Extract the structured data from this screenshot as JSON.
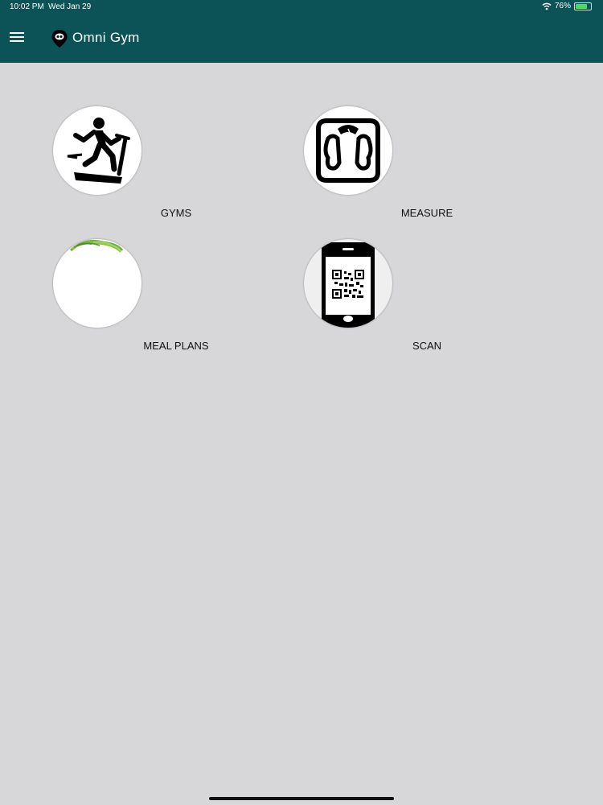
{
  "status_bar": {
    "time": "10:02 PM",
    "date": "Wed Jan 29",
    "battery_percent": "76%",
    "battery_level": 0.76,
    "icons": [
      "wifi-icon",
      "battery-icon"
    ]
  },
  "app_bar": {
    "title": "Omni Gym",
    "menu_icon": "hamburger-menu-icon",
    "logo_icon": "location-pin-logo-icon",
    "background_color": "#0c5357"
  },
  "tiles": [
    {
      "label": "GYMS",
      "icon": "treadmill-runner-icon"
    },
    {
      "label": "MEASURE",
      "icon": "bathroom-scale-icon"
    },
    {
      "label": "MEAL PLANS",
      "icon": "salad-plate-icon"
    },
    {
      "label": "SCAN",
      "icon": "phone-qr-code-icon"
    }
  ],
  "colors": {
    "background": "#d7d6d8",
    "accent_green": "#6db33f"
  }
}
